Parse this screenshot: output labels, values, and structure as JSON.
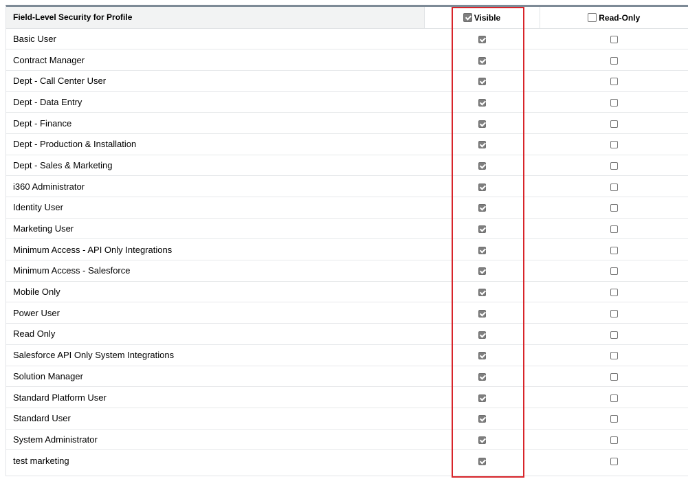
{
  "table": {
    "header": {
      "name_label": "Field-Level Security for Profile",
      "visible_label": "Visible",
      "visible_checked": true,
      "readonly_label": "Read-Only",
      "readonly_checked": false
    },
    "rows": [
      {
        "profile": "Basic User",
        "visible": true,
        "read_only": false
      },
      {
        "profile": "Contract Manager",
        "visible": true,
        "read_only": false
      },
      {
        "profile": "Dept - Call Center User",
        "visible": true,
        "read_only": false
      },
      {
        "profile": "Dept - Data Entry",
        "visible": true,
        "read_only": false
      },
      {
        "profile": "Dept - Finance",
        "visible": true,
        "read_only": false
      },
      {
        "profile": "Dept - Production & Installation",
        "visible": true,
        "read_only": false
      },
      {
        "profile": "Dept - Sales & Marketing",
        "visible": true,
        "read_only": false
      },
      {
        "profile": "i360 Administrator",
        "visible": true,
        "read_only": false
      },
      {
        "profile": "Identity User",
        "visible": true,
        "read_only": false
      },
      {
        "profile": "Marketing User",
        "visible": true,
        "read_only": false
      },
      {
        "profile": "Minimum Access - API Only Integrations",
        "visible": true,
        "read_only": false
      },
      {
        "profile": "Minimum Access - Salesforce",
        "visible": true,
        "read_only": false
      },
      {
        "profile": "Mobile Only",
        "visible": true,
        "read_only": false
      },
      {
        "profile": "Power User",
        "visible": true,
        "read_only": false
      },
      {
        "profile": "Read Only",
        "visible": true,
        "read_only": false
      },
      {
        "profile": "Salesforce API Only System Integrations",
        "visible": true,
        "read_only": false
      },
      {
        "profile": "Solution Manager",
        "visible": true,
        "read_only": false
      },
      {
        "profile": "Standard Platform User",
        "visible": true,
        "read_only": false
      },
      {
        "profile": "Standard User",
        "visible": true,
        "read_only": false
      },
      {
        "profile": "System Administrator",
        "visible": true,
        "read_only": false
      },
      {
        "profile": "test marketing",
        "visible": true,
        "read_only": false
      }
    ]
  },
  "colors": {
    "highlight": "#d8242a",
    "header_bg": "#f2f3f3",
    "top_border": "#7d8a96"
  }
}
